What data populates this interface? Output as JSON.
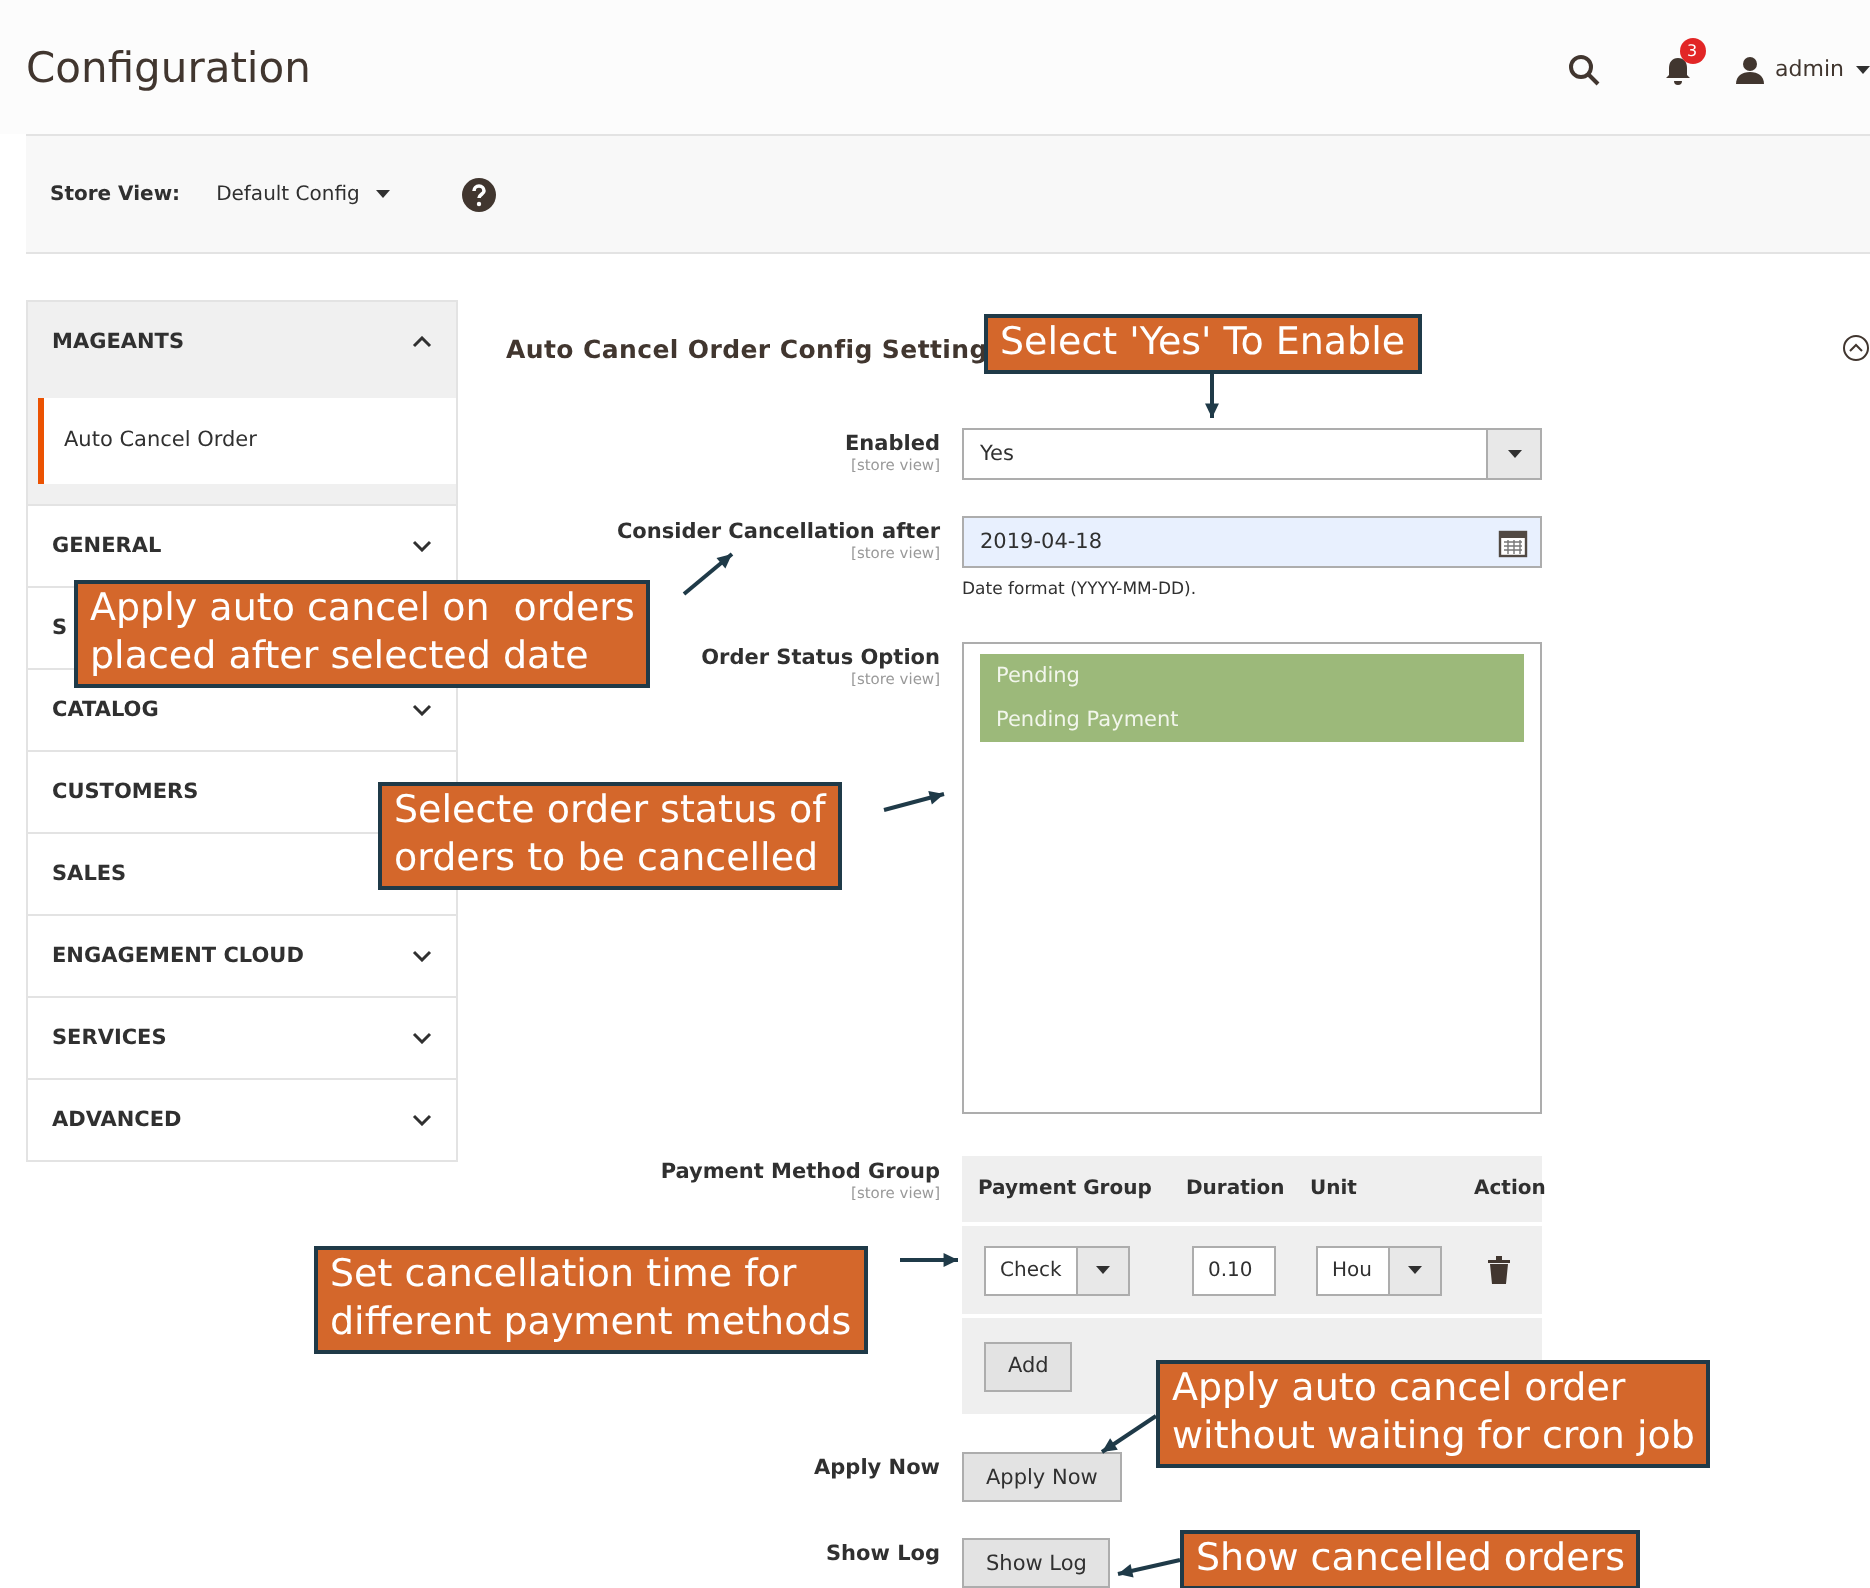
{
  "header": {
    "title": "Configuration",
    "notifications": "3",
    "user": "admin"
  },
  "store_view": {
    "label": "Store View:",
    "value": "Default Config"
  },
  "sidebar": {
    "sections": [
      {
        "label": "MAGEANTS",
        "expanded": true,
        "children": [
          {
            "label": "Auto Cancel Order",
            "selected": true
          }
        ]
      },
      {
        "label": "GENERAL",
        "expanded": false
      },
      {
        "label": "S",
        "expanded": false
      },
      {
        "label": "CATALOG",
        "expanded": false
      },
      {
        "label": "CUSTOMERS",
        "expanded": false
      },
      {
        "label": "SALES",
        "expanded": false
      },
      {
        "label": "ENGAGEMENT CLOUD",
        "expanded": false
      },
      {
        "label": "SERVICES",
        "expanded": false
      },
      {
        "label": "ADVANCED",
        "expanded": false
      }
    ]
  },
  "section": {
    "title": "Auto Cancel Order Config Setting",
    "expanded": true
  },
  "fields": [
    {
      "kind": "select",
      "label": "Enabled",
      "scope": "[store view]",
      "value": "Yes"
    },
    {
      "kind": "date",
      "label": "Consider Cancellation after",
      "scope": "[store view]",
      "value": "2019-04-18",
      "note": "Date format (YYYY-MM-DD)."
    },
    {
      "kind": "multiselect",
      "label": "Order Status Option",
      "scope": "[store view]",
      "options": [
        {
          "label": "Pending",
          "selected": true
        },
        {
          "label": "Pending Payment",
          "selected": true
        }
      ]
    },
    {
      "kind": "table",
      "label": "Payment Method Group",
      "scope": "[store view]",
      "columns": [
        "Payment Group",
        "Duration",
        "Unit",
        "Action"
      ],
      "rows": [
        {
          "payment_group": "Check",
          "duration": "0.10",
          "unit": "Hou"
        }
      ],
      "add_button": "Add"
    },
    {
      "kind": "button",
      "label": "Apply Now",
      "button": "Apply Now"
    },
    {
      "kind": "button",
      "label": "Show Log",
      "button": "Show Log"
    }
  ],
  "callouts": [
    {
      "text": "Select 'Yes' To Enable"
    },
    {
      "text": "Apply auto cancel on  orders\nplaced after selected date"
    },
    {
      "text": "Selecte order status of\norders to be cancelled"
    },
    {
      "text": "Set cancellation time for\ndifferent payment methods"
    },
    {
      "text": "Apply auto cancel order\nwithout waiting for cron job"
    },
    {
      "text": "Show cancelled orders"
    }
  ]
}
